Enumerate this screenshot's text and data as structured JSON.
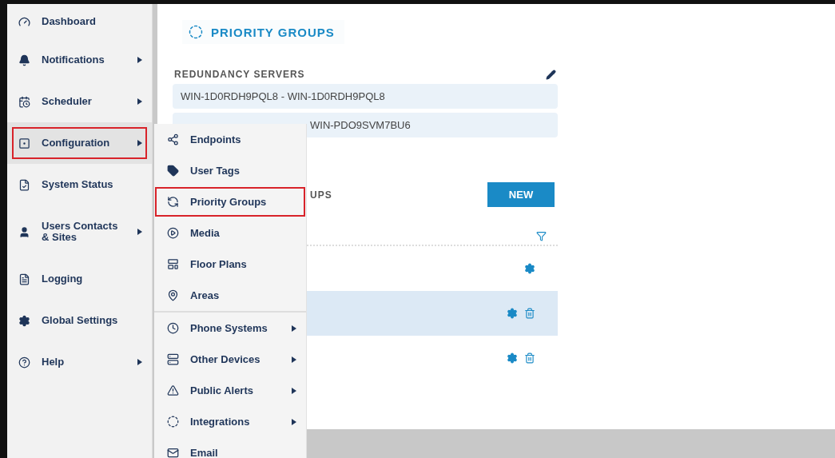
{
  "sidebar": {
    "items": [
      {
        "label": "Dashboard",
        "submenu": false,
        "selected": false
      },
      {
        "label": "Notifications",
        "submenu": true,
        "selected": false
      },
      {
        "label": "Scheduler",
        "submenu": true,
        "selected": false
      },
      {
        "label": "Configuration",
        "submenu": true,
        "selected": true
      },
      {
        "label": "System Status",
        "submenu": false,
        "selected": false
      },
      {
        "label": "Users Contacts & Sites",
        "submenu": true,
        "selected": false
      },
      {
        "label": "Logging",
        "submenu": false,
        "selected": false
      },
      {
        "label": "Global Settings",
        "submenu": false,
        "selected": false
      },
      {
        "label": "Help",
        "submenu": true,
        "selected": false
      }
    ]
  },
  "flyout": {
    "sections": [
      {
        "items": [
          {
            "label": "Endpoints",
            "submenu": false,
            "selected": false
          },
          {
            "label": "User Tags",
            "submenu": false,
            "selected": false
          },
          {
            "label": "Priority Groups",
            "submenu": false,
            "selected": true
          },
          {
            "label": "Media",
            "submenu": false,
            "selected": false
          },
          {
            "label": "Floor Plans",
            "submenu": false,
            "selected": false
          },
          {
            "label": "Areas",
            "submenu": false,
            "selected": false
          }
        ]
      },
      {
        "items": [
          {
            "label": "Phone Systems",
            "submenu": true,
            "selected": false
          },
          {
            "label": "Other Devices",
            "submenu": true,
            "selected": false
          },
          {
            "label": "Public Alerts",
            "submenu": true,
            "selected": false
          },
          {
            "label": "Integrations",
            "submenu": true,
            "selected": false
          },
          {
            "label": "Email",
            "submenu": false,
            "selected": false
          }
        ]
      }
    ]
  },
  "page": {
    "title": "PRIORITY GROUPS",
    "servers": {
      "label": "REDUNDANCY SERVERS",
      "rows": [
        "WIN-1D0RDH9PQL8 - WIN-1D0RDH9PQL8",
        "WIN-PDO9SVM7BU6"
      ]
    },
    "groups": {
      "heading": "UPS",
      "new_button": "NEW",
      "rows": [
        {
          "selected": false,
          "deletable": false
        },
        {
          "selected": true,
          "deletable": true
        },
        {
          "selected": false,
          "deletable": true
        }
      ]
    }
  }
}
